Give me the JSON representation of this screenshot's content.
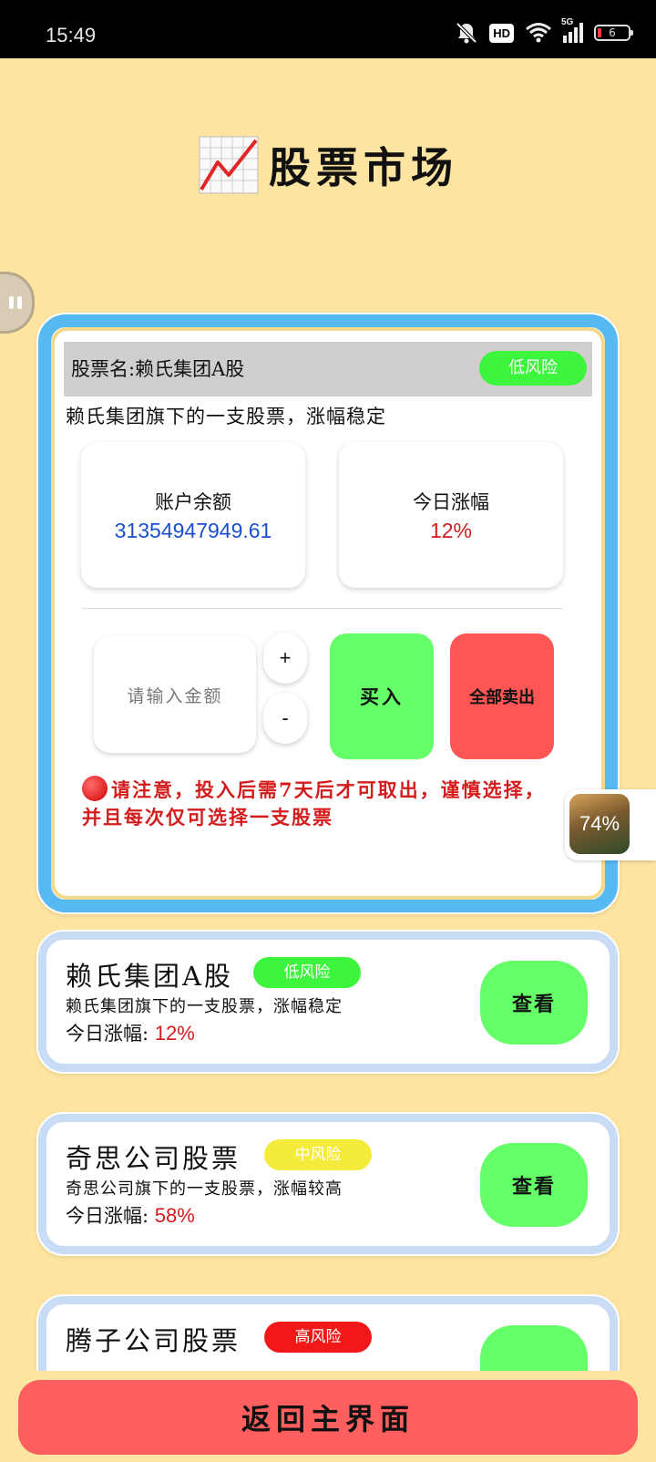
{
  "status_bar": {
    "time": "15:49",
    "hd": "HD",
    "network": "5G",
    "battery": "6",
    "icons": [
      "mute-bell-icon",
      "hd-icon",
      "wifi-icon",
      "signal-5g-icon",
      "battery-icon"
    ]
  },
  "header": {
    "icon": "chart-increasing-icon",
    "title": "股票市场"
  },
  "detail": {
    "stock_name": "股票名:赖氏集团A股",
    "risk": "低风险",
    "risk_color": "#3cf53c",
    "description": "赖氏集团旗下的一支股票，涨幅稳定",
    "balance_label": "账户余额",
    "balance_value": "31354947949.61",
    "balance_color": "#1b4fd1",
    "rise_label": "今日涨幅",
    "rise_value": "12%",
    "rise_color": "#d41c1c",
    "amount_placeholder": "请输入金额",
    "plus_label": "+",
    "minus_label": "-",
    "buy_label": "买入",
    "buy_color": "#65ff6a",
    "sell_all_label": "全部卖出",
    "sell_color": "#ff5555",
    "warning": "请注意，投入后需7天后才可取出，谨慎选择，并且每次仅可选择一支股票"
  },
  "float_video": {
    "percent": "74%"
  },
  "stocks": [
    {
      "name": "赖氏集团A股",
      "risk": "低风险",
      "risk_color": "#3cf53c",
      "desc": "赖氏集团旗下的一支股票，涨幅稳定",
      "rise_label": "今日涨幅:",
      "rise": "12%",
      "view_label": "查看"
    },
    {
      "name": "奇思公司股票",
      "risk": "中风险",
      "risk_color": "#f5eb3c",
      "desc": "奇思公司旗下的一支股票，涨幅较高",
      "rise_label": "今日涨幅:",
      "rise": "58%",
      "view_label": "查看"
    },
    {
      "name": "腾子公司股票",
      "risk": "高风险",
      "risk_color": "#f21818",
      "desc": "",
      "rise_label": "",
      "rise": "",
      "view_label": ""
    }
  ],
  "footer": {
    "return_label": "返回主界面"
  }
}
